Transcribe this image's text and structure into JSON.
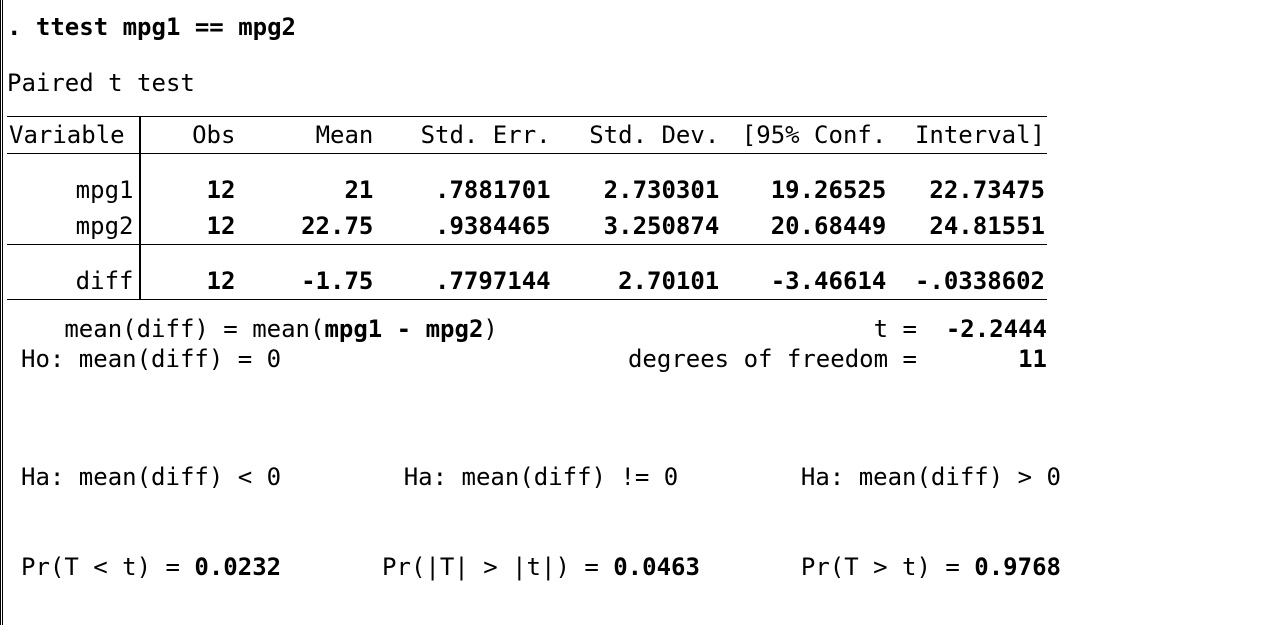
{
  "command_prefix": ". ",
  "command": "ttest mpg1 == mpg2",
  "test_title": "Paired t test",
  "columns": {
    "var": "Variable",
    "obs": "Obs",
    "mean": "Mean",
    "se": "Std. Err.",
    "sd": "Std. Dev.",
    "ci_lo": "[95% Conf.",
    "ci_hi": "Interval]"
  },
  "rows": [
    {
      "name": "mpg1",
      "obs": "12",
      "mean": "21",
      "se": ".7881701",
      "sd": "2.730301",
      "lo": "19.26525",
      "hi": "22.73475"
    },
    {
      "name": "mpg2",
      "obs": "12",
      "mean": "22.75",
      "se": ".9384465",
      "sd": "3.250874",
      "lo": "20.68449",
      "hi": "24.81551"
    }
  ],
  "diff": {
    "name": "diff",
    "obs": "12",
    "mean": "-1.75",
    "se": ".7797144",
    "sd": "2.70101",
    "lo": "-3.46614",
    "hi": "-.0338602"
  },
  "mean_def": {
    "prefix": "   mean(diff) = mean(",
    "var1": "mpg1",
    "mid": " - ",
    "var2": "mpg2",
    "suffix": ")"
  },
  "t_label": "t = ",
  "t_value": " -2.2444",
  "ho": "Ho: mean(diff) = 0",
  "df_label": "degrees of freedom = ",
  "df_value": "      11",
  "alts": {
    "lt": {
      "ha": "Ha: mean(diff) < 0",
      "pr_label": "Pr(T < t) = ",
      "pr_value": "0.0232"
    },
    "ne": {
      "ha": "Ha: mean(diff) != 0",
      "pr_label": "Pr(|T| > |t|) = ",
      "pr_value": "0.0463"
    },
    "gt": {
      "ha": "Ha: mean(diff) > 0",
      "pr_label": "Pr(T > t) = ",
      "pr_value": "0.9768"
    }
  }
}
